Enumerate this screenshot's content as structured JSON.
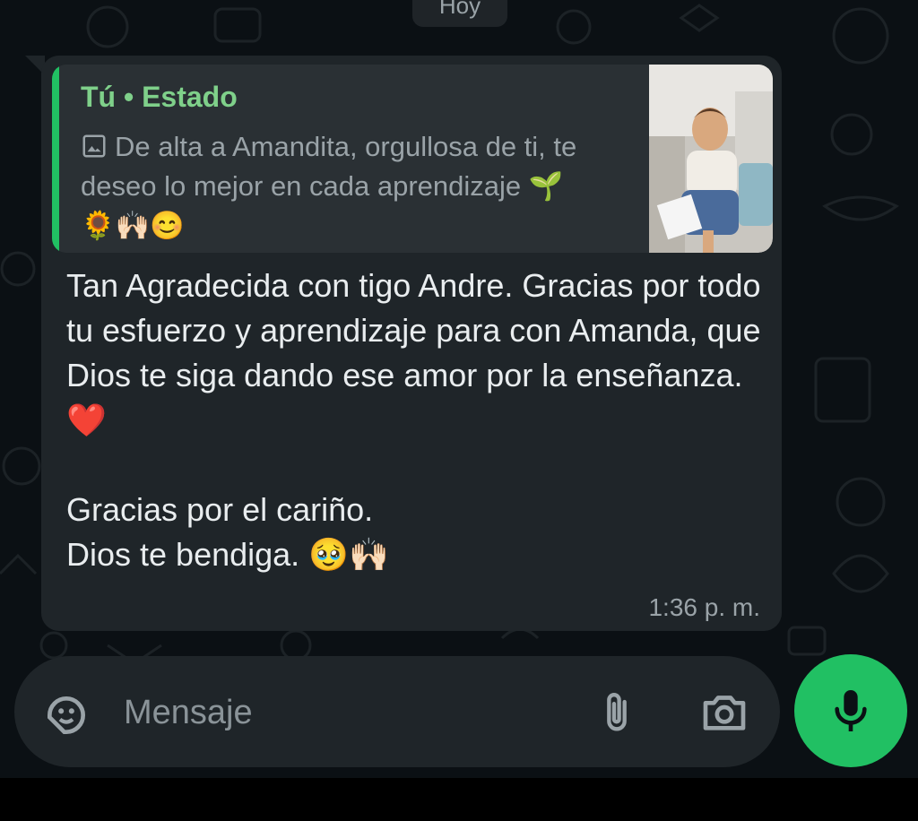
{
  "colors": {
    "background": "#0b1014",
    "bubble": "#1f2529",
    "quote_bg": "#2a3034",
    "accent_green": "#21c063",
    "author_green": "#7fd08a",
    "text_primary": "#e9edef",
    "text_secondary": "#9aa3a8"
  },
  "date_chip": "Hoy",
  "message": {
    "quoted": {
      "author": "Tú • Estado",
      "icon": "image-icon",
      "text": "De alta a Amandita, orgullosa de ti, te deseo lo mejor en cada aprendizaje 🌱🌻🙌🏻😊",
      "thumbnail": "status-photo-thumbnail"
    },
    "body": "Tan Agradecida con tigo Andre. Gracias por todo tu esfuerzo y aprendizaje para con Amanda, que Dios te siga dando ese amor por la enseñanza.❤️\n\nGracias por el cariño.\nDios te bendiga. 🥹🙌🏻",
    "time": "1:36 p. m."
  },
  "composer": {
    "placeholder": "Mensaje",
    "emoji_icon": "sticker-icon",
    "attach_icon": "paperclip-icon",
    "camera_icon": "camera-icon",
    "mic_icon": "microphone-icon"
  }
}
